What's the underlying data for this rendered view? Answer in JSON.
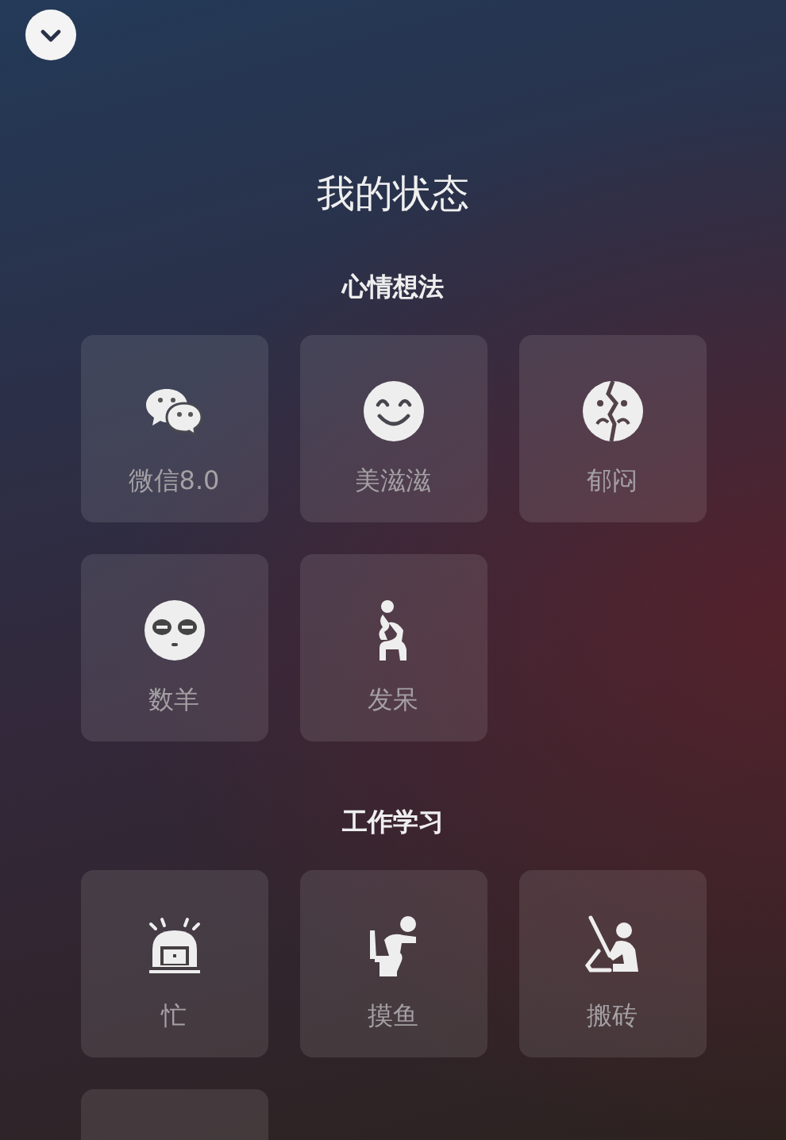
{
  "title": "我的状态",
  "sections": [
    {
      "heading": "心情想法",
      "items": [
        {
          "kind": "chat",
          "label": "微信8.0"
        },
        {
          "kind": "smile",
          "label": "美滋滋"
        },
        {
          "kind": "cracked",
          "label": "郁闷"
        },
        {
          "kind": "sleepy",
          "label": "数羊"
        },
        {
          "kind": "thinker",
          "label": "发呆"
        }
      ]
    },
    {
      "heading": "工作学习",
      "items": [
        {
          "kind": "busy",
          "label": "忙"
        },
        {
          "kind": "slacking",
          "label": "摸鱼"
        },
        {
          "kind": "bricks",
          "label": "搬砖"
        },
        {
          "kind": "cut"
        }
      ]
    }
  ]
}
